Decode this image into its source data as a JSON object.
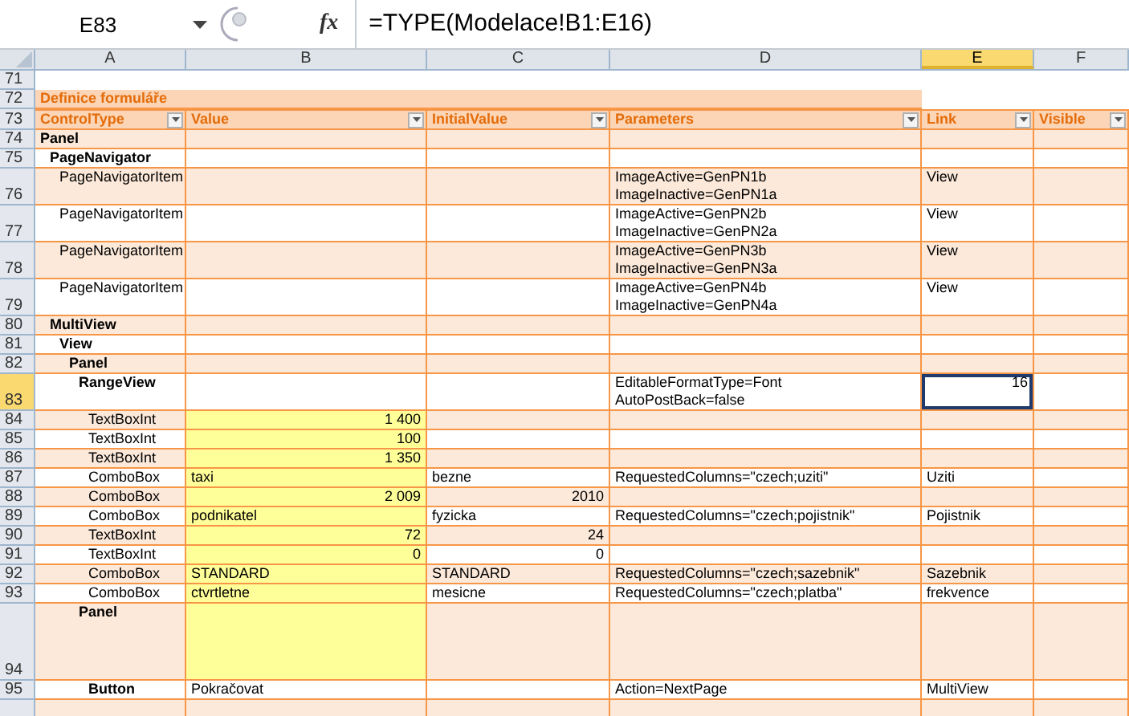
{
  "name_box": "E83",
  "fx": "fx",
  "formula": "=TYPE(Modelace!B1:E16)",
  "columns": [
    {
      "label": "A",
      "selected": false
    },
    {
      "label": "B",
      "selected": false
    },
    {
      "label": "C",
      "selected": false
    },
    {
      "label": "D",
      "selected": false
    },
    {
      "label": "E",
      "selected": true
    },
    {
      "label": "F",
      "selected": false
    }
  ],
  "blank_row": "71",
  "title": {
    "row": "72",
    "text": "Definice formuláře"
  },
  "table_header": {
    "row": "73",
    "cells": [
      "ControlType",
      "Value",
      "InitialValue",
      "Parameters",
      "Link",
      "Visible"
    ]
  },
  "tree": [
    {
      "row": "74",
      "control": "Panel",
      "bold": true,
      "selected": false,
      "children": [
        {
          "row": "75",
          "control": "PageNavigator",
          "bold": true,
          "selected": false,
          "children": [
            {
              "row": "76",
              "control": "PageNavigatorItem",
              "bold": false,
              "selected": false,
              "parameters": "ImageActive=GenPN1b\nImageInactive=GenPN1a",
              "link": "View"
            },
            {
              "row": "77",
              "control": "PageNavigatorItem",
              "bold": false,
              "selected": false,
              "parameters": "ImageActive=GenPN2b\nImageInactive=GenPN2a",
              "link": "View"
            },
            {
              "row": "78",
              "control": "PageNavigatorItem",
              "bold": false,
              "selected": false,
              "parameters": "ImageActive=GenPN3b\nImageInactive=GenPN3a",
              "link": "View"
            },
            {
              "row": "79",
              "control": "PageNavigatorItem",
              "bold": false,
              "selected": false,
              "parameters": "ImageActive=GenPN4b\nImageInactive=GenPN4a",
              "link": "View"
            }
          ]
        },
        {
          "row": "80",
          "control": "MultiView",
          "bold": true,
          "selected": false,
          "children": [
            {
              "row": "81",
              "control": "View",
              "bold": true,
              "selected": false,
              "children": [
                {
                  "row": "82",
                  "control": "Panel",
                  "bold": true,
                  "selected": false,
                  "children": [
                    {
                      "row": "83",
                      "control": "RangeView",
                      "bold": true,
                      "selected": true,
                      "parameters": "EditableFormatType=Font\nAutoPostBack=false",
                      "link": {
                        "text": "16",
                        "numeric": true
                      },
                      "children": [
                        {
                          "row": "84",
                          "control": "TextBoxInt",
                          "bold": false,
                          "selected": false,
                          "input": true,
                          "value": {
                            "text": "1 400",
                            "numeric": true
                          }
                        },
                        {
                          "row": "85",
                          "control": "TextBoxInt",
                          "bold": false,
                          "selected": false,
                          "input": true,
                          "value": {
                            "text": "100",
                            "numeric": true
                          }
                        },
                        {
                          "row": "86",
                          "control": "TextBoxInt",
                          "bold": false,
                          "selected": false,
                          "input": true,
                          "value": {
                            "text": "1 350",
                            "numeric": true
                          }
                        },
                        {
                          "row": "87",
                          "control": "ComboBox",
                          "bold": false,
                          "selected": false,
                          "input": true,
                          "value": {
                            "text": "taxi",
                            "numeric": false
                          },
                          "initial": {
                            "text": "bezne",
                            "numeric": false
                          },
                          "parameters": "RequestedColumns=\"czech;uziti\"",
                          "link": "Uziti"
                        },
                        {
                          "row": "88",
                          "control": "ComboBox",
                          "bold": false,
                          "selected": false,
                          "input": true,
                          "value": {
                            "text": "2 009",
                            "numeric": true
                          },
                          "initial": {
                            "text": "2010",
                            "numeric": true
                          }
                        },
                        {
                          "row": "89",
                          "control": "ComboBox",
                          "bold": false,
                          "selected": false,
                          "input": true,
                          "value": {
                            "text": "podnikatel",
                            "numeric": false
                          },
                          "initial": {
                            "text": "fyzicka",
                            "numeric": false
                          },
                          "parameters": "RequestedColumns=\"czech;pojistnik\"",
                          "link": "Pojistnik"
                        },
                        {
                          "row": "90",
                          "control": "TextBoxInt",
                          "bold": false,
                          "selected": false,
                          "input": true,
                          "value": {
                            "text": "72",
                            "numeric": true
                          },
                          "initial": {
                            "text": "24",
                            "numeric": true
                          }
                        },
                        {
                          "row": "91",
                          "control": "TextBoxInt",
                          "bold": false,
                          "selected": false,
                          "input": true,
                          "value": {
                            "text": "0",
                            "numeric": true
                          },
                          "initial": {
                            "text": "0",
                            "numeric": true
                          }
                        },
                        {
                          "row": "92",
                          "control": "ComboBox",
                          "bold": false,
                          "selected": false,
                          "input": true,
                          "value": {
                            "text": "STANDARD",
                            "numeric": false
                          },
                          "initial": {
                            "text": "STANDARD",
                            "numeric": false
                          },
                          "parameters": "RequestedColumns=\"czech;sazebnik\"",
                          "link": "Sazebnik"
                        },
                        {
                          "row": "93",
                          "control": "ComboBox",
                          "bold": false,
                          "selected": false,
                          "input": true,
                          "value": {
                            "text": "ctvrtletne",
                            "numeric": false
                          },
                          "initial": {
                            "text": "mesicne",
                            "numeric": false
                          },
                          "parameters": "RequestedColumns=\"czech;platba\"",
                          "link": "frekvence"
                        }
                      ]
                    },
                    {
                      "row": "94",
                      "control": "Panel",
                      "bold": true,
                      "selected": false,
                      "input": true,
                      "tall": true,
                      "children": [
                        {
                          "row": "95",
                          "control": "Button",
                          "bold": true,
                          "selected": false,
                          "value": {
                            "text": "Pokračovat",
                            "numeric": false
                          },
                          "parameters": "Action=NextPage",
                          "link": "MultiView"
                        }
                      ]
                    }
                  ]
                }
              ]
            }
          ]
        }
      ]
    }
  ]
}
